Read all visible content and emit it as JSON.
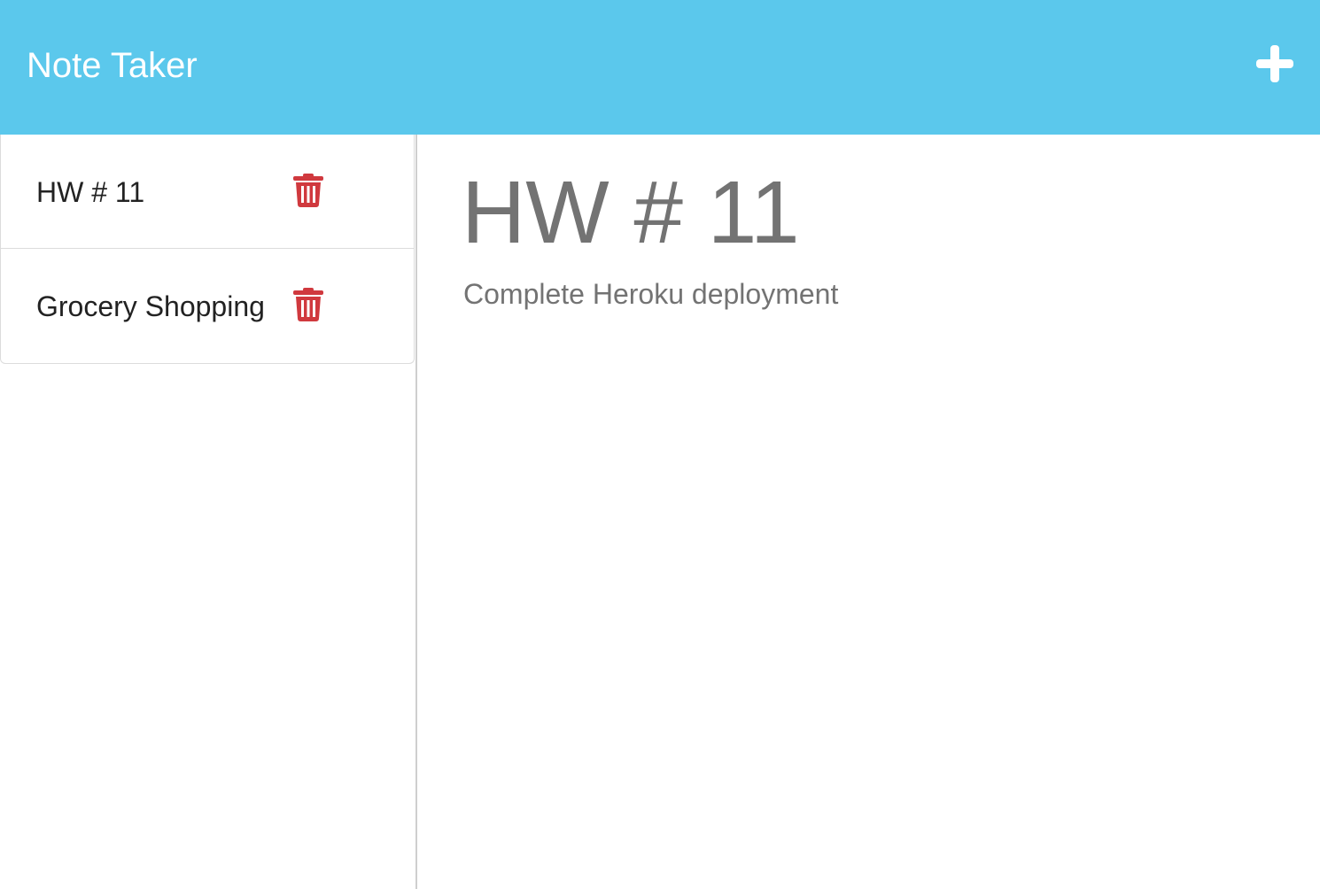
{
  "navbar": {
    "brand": "Note Taker",
    "new_note_icon": "plus-icon",
    "background_color": "#5bc8ec"
  },
  "notes": [
    {
      "title": "HW # 11",
      "delete_icon": "trash-icon"
    },
    {
      "title": "Grocery Shopping",
      "delete_icon": "trash-icon"
    }
  ],
  "active_note": {
    "title": "HW # 11",
    "text": "Complete Heroku deployment"
  },
  "colors": {
    "delete_icon": "#d0393e",
    "note_text": "#737373"
  }
}
